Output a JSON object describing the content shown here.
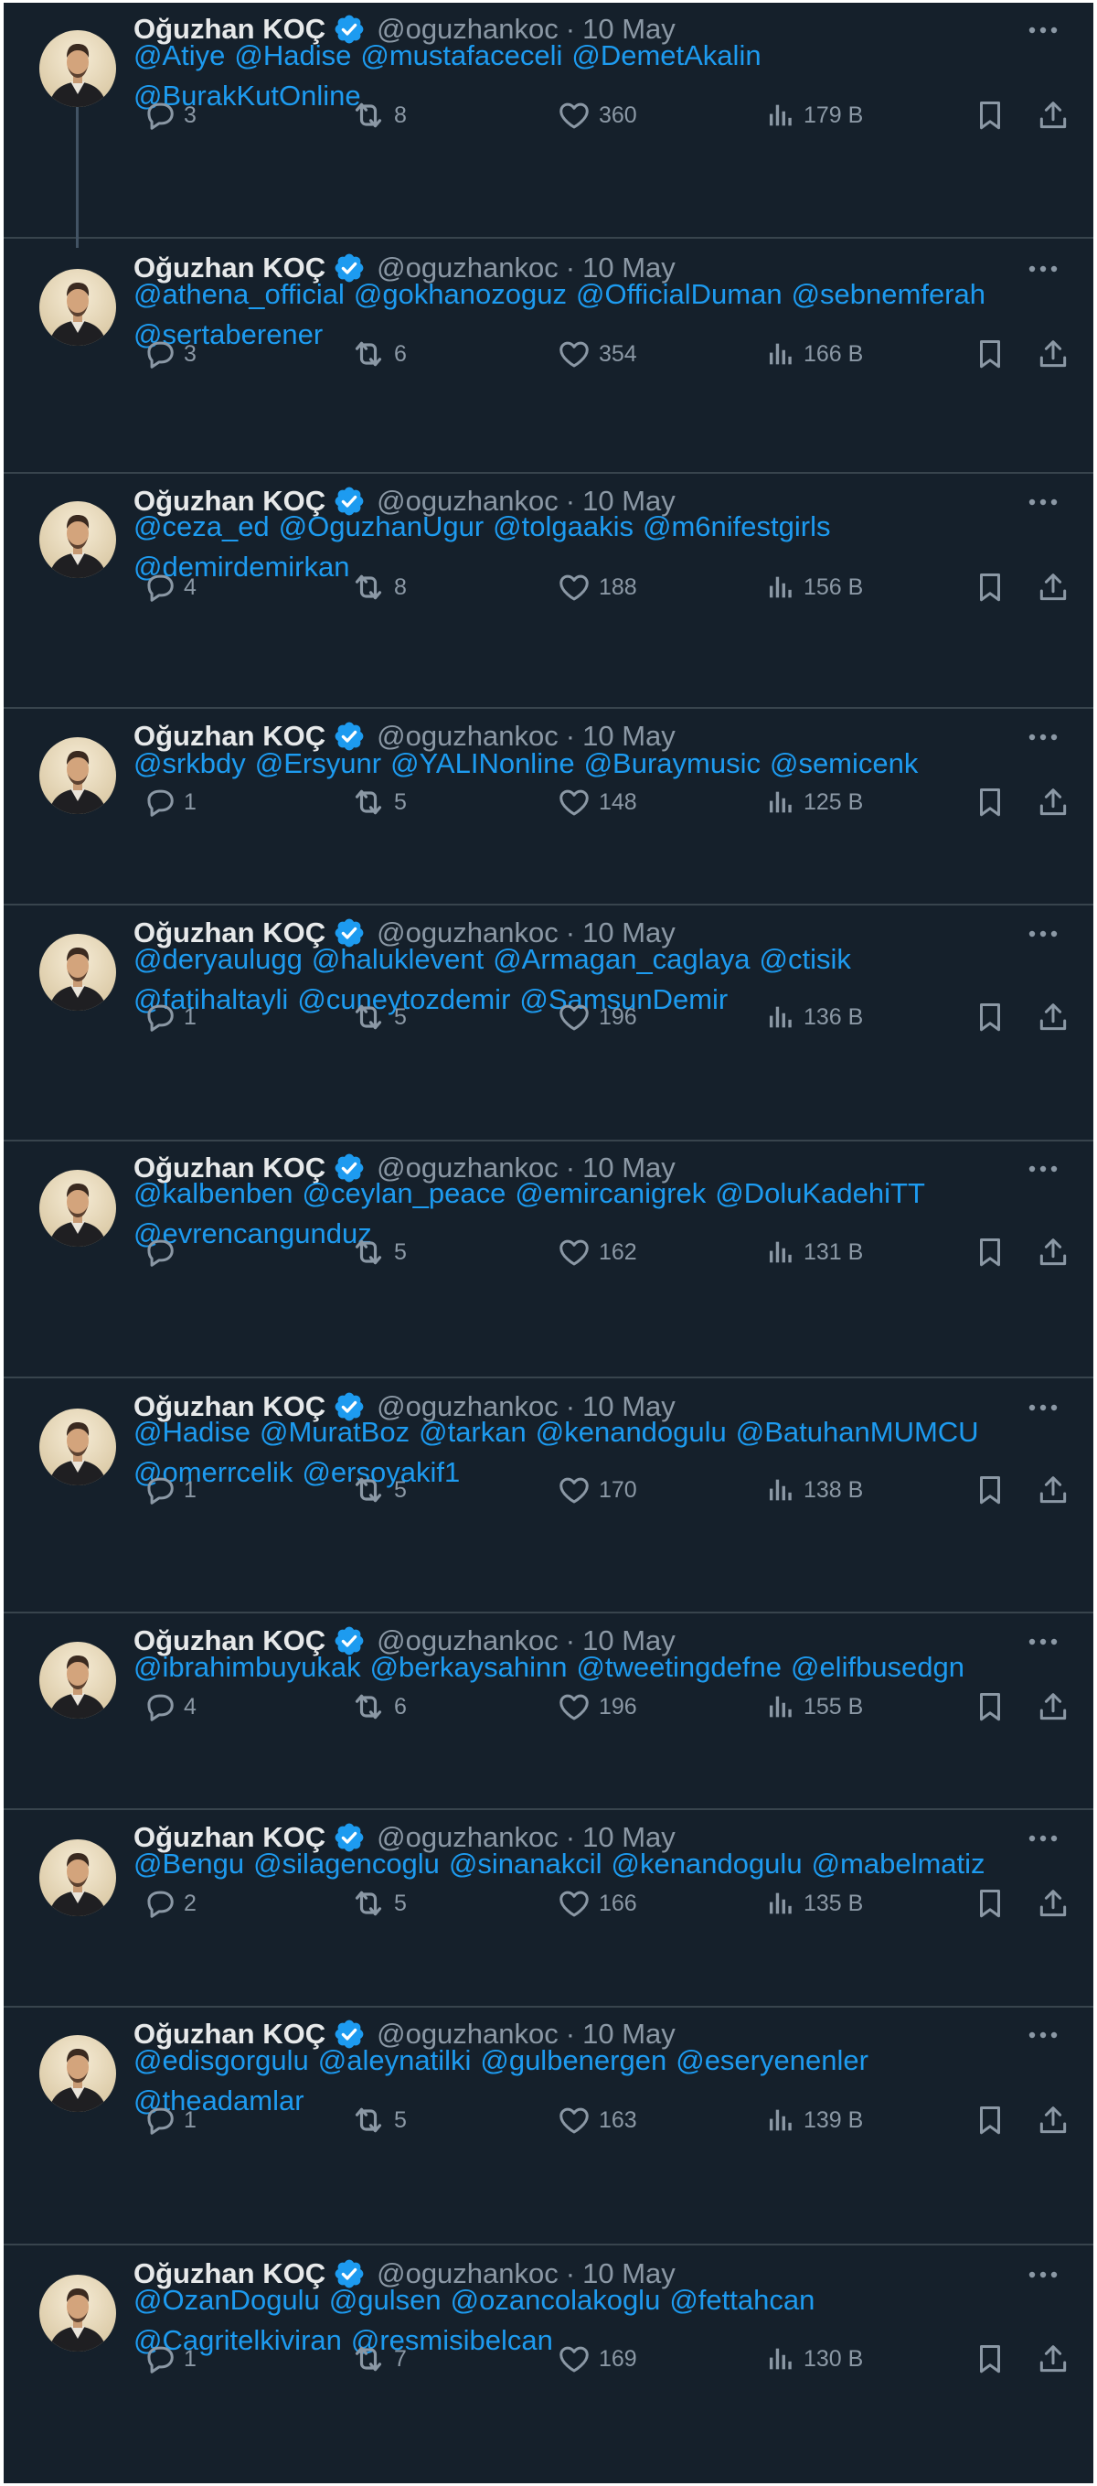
{
  "author": {
    "name": "Oğuzhan KOÇ",
    "handle": "@oguzhankoc",
    "date": "10 May",
    "separator": "·"
  },
  "colors": {
    "background": "#15202b",
    "divider": "#38444d",
    "link": "#1d9bf0",
    "muted": "#8b98a5",
    "name": "#e7e9ea"
  },
  "icons": {
    "more": "more-horizontal-icon",
    "verified": "verified-badge-icon",
    "reply": "reply-icon",
    "retweet": "retweet-icon",
    "like": "heart-icon",
    "views": "analytics-icon",
    "bookmark": "bookmark-icon",
    "share": "share-icon"
  },
  "tweets": [
    {
      "mentions": [
        "@Atiye",
        "@Hadise",
        "@mustafaceceli",
        "@DemetAkalin",
        "@BurakKutOnline"
      ],
      "replies": "3",
      "retweets": "8",
      "likes": "360",
      "views": "179 B"
    },
    {
      "mentions": [
        "@athena_official",
        "@gokhanozoguz",
        "@OfficialDuman",
        "@sebnemferah",
        "@sertaberener"
      ],
      "replies": "3",
      "retweets": "6",
      "likes": "354",
      "views": "166 B"
    },
    {
      "mentions": [
        "@ceza_ed",
        "@OguzhanUgur",
        "@tolgaakis",
        "@m6nifestgirls",
        "@demirdemirkan"
      ],
      "replies": "4",
      "retweets": "8",
      "likes": "188",
      "views": "156 B"
    },
    {
      "mentions": [
        "@srkbdy",
        "@Ersyunr",
        "@YALINonline",
        "@Buraymusic",
        "@semicenk"
      ],
      "replies": "1",
      "retweets": "5",
      "likes": "148",
      "views": "125 B"
    },
    {
      "mentions": [
        "@deryaulugg",
        "@haluklevent",
        "@Armagan_caglaya",
        "@ctisik",
        "@fatihaltayli",
        "@cuneytozdemir",
        "@SamsunDemir"
      ],
      "replies": "1",
      "retweets": "5",
      "likes": "196",
      "views": "136 B"
    },
    {
      "mentions": [
        "@kalbenben",
        "@ceylan_peace",
        "@emircanigrek",
        "@DoluKadehiTT",
        "@evrencangunduz"
      ],
      "replies": "",
      "retweets": "5",
      "likes": "162",
      "views": "131 B"
    },
    {
      "mentions": [
        "@Hadise",
        "@MuratBoz",
        "@tarkan",
        "@kenandogulu",
        "@BatuhanMUMCU",
        "@omerrcelik",
        "@ersoyakif1"
      ],
      "replies": "1",
      "retweets": "5",
      "likes": "170",
      "views": "138 B"
    },
    {
      "mentions": [
        "@ibrahimbuyukak",
        "@berkaysahinn",
        "@tweetingdefne",
        "@elifbusedgn"
      ],
      "replies": "4",
      "retweets": "6",
      "likes": "196",
      "views": "155 B"
    },
    {
      "mentions": [
        "@Bengu",
        "@silagencoglu",
        "@sinanakcil",
        "@kenandogulu",
        "@mabelmatiz"
      ],
      "replies": "2",
      "retweets": "5",
      "likes": "166",
      "views": "135 B"
    },
    {
      "mentions": [
        "@edisgorgulu",
        "@aleynatilki",
        "@gulbenergen",
        "@eseryenenler",
        "@theadamlar"
      ],
      "replies": "1",
      "retweets": "5",
      "likes": "163",
      "views": "139 B"
    },
    {
      "mentions": [
        "@OzanDogulu",
        "@gulsen",
        "@ozancolakoglu",
        "@fettahcan",
        "@Cagritelkiviran",
        "@resmisibelcan"
      ],
      "replies": "1",
      "retweets": "7",
      "likes": "169",
      "views": "130 B"
    }
  ]
}
